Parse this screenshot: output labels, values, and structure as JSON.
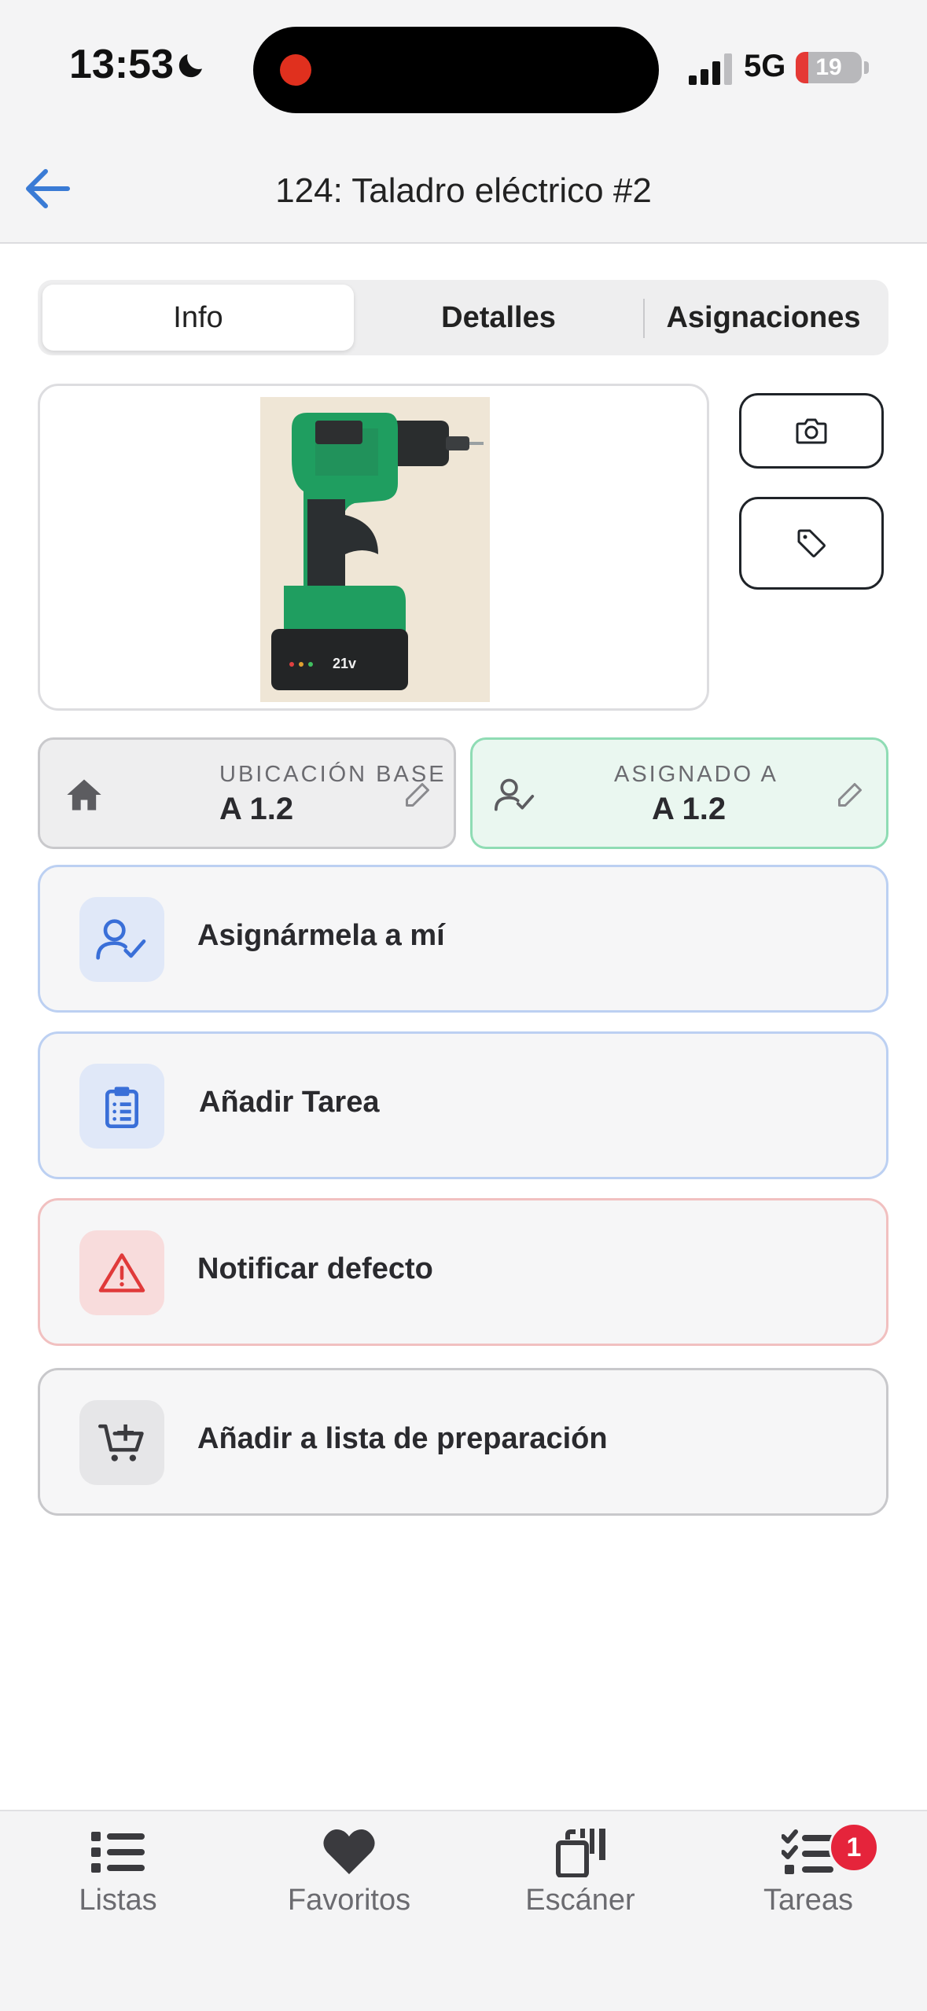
{
  "status_bar": {
    "time": "13:53",
    "network": "5G",
    "battery": "19",
    "battery_level": 0.19
  },
  "header": {
    "title": "124: Taladro eléctrico #2"
  },
  "tabs": [
    {
      "label": "Info",
      "active": true
    },
    {
      "label": "Detalles",
      "active": false
    },
    {
      "label": "Asignaciones",
      "active": false
    }
  ],
  "item_photo": {
    "voltage_text": "21v"
  },
  "side_buttons": {
    "camera_icon": "camera-icon",
    "tag_icon": "tag-icon"
  },
  "location": {
    "base_label": "UBICACIÓN BASE",
    "base_value": "A 1.2",
    "assigned_label": "ASIGNADO A",
    "assigned_value": "A 1.2"
  },
  "actions": [
    {
      "label": "Asignármela a mí",
      "icon": "user-check-icon",
      "tone": "blue"
    },
    {
      "label": "Añadir Tarea",
      "icon": "clipboard-list-icon",
      "tone": "blue"
    },
    {
      "label": "Notificar defecto",
      "icon": "warning-triangle-icon",
      "tone": "red"
    },
    {
      "label": "Añadir a lista de preparación",
      "icon": "cart-plus-icon",
      "tone": "gray"
    }
  ],
  "bottom_nav": [
    {
      "label": "Listas",
      "icon": "list-icon"
    },
    {
      "label": "Favoritos",
      "icon": "heart-icon"
    },
    {
      "label": "Escáner",
      "icon": "scanner-icon"
    },
    {
      "label": "Tareas",
      "icon": "tasks-icon",
      "badge": "1"
    }
  ],
  "colors": {
    "accent": "#3a7bd5",
    "danger": "#e03a3a",
    "success_border": "#8fdcb4"
  }
}
